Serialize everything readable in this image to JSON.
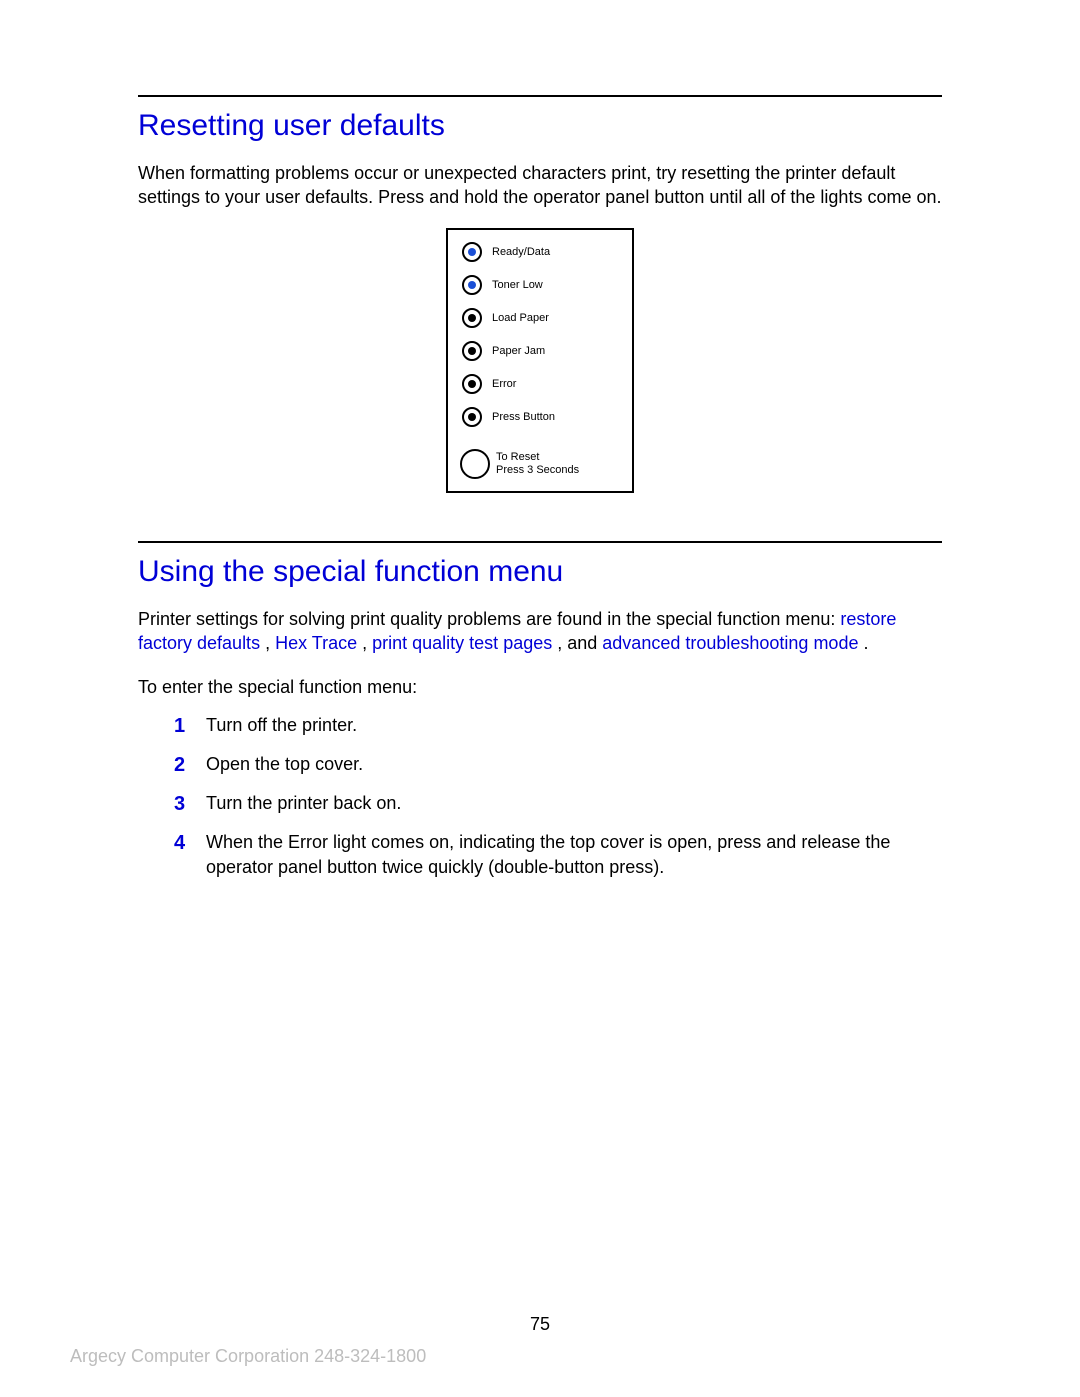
{
  "section1": {
    "heading": "Resetting user defaults",
    "body": "When formatting problems occur or unexpected characters print, try resetting the printer default settings to your user defaults. Press and hold the operator panel button until all of the lights come on."
  },
  "panel": {
    "lights": [
      {
        "label": "Ready/Data",
        "color": "blue"
      },
      {
        "label": "Toner Low",
        "color": "blue"
      },
      {
        "label": "Load Paper",
        "color": "black"
      },
      {
        "label": "Paper Jam",
        "color": "black"
      },
      {
        "label": "Error",
        "color": "black"
      },
      {
        "label": "Press Button",
        "color": "black"
      }
    ],
    "button_line1": "To Reset",
    "button_line2": "Press 3 Seconds"
  },
  "section2": {
    "heading": "Using the special function menu",
    "intro_prefix": "Printer settings for solving print quality problems are found in the special function menu: ",
    "links": {
      "a": "restore factory defaults",
      "b": "Hex Trace",
      "c": "print quality test pages",
      "d": "advanced troubleshooting mode"
    },
    "sep1": " , ",
    "sep2": " , ",
    "sep3": "  , and ",
    "tail": "  .",
    "enter_text": "To enter the special function menu:",
    "steps": [
      "Turn off the printer.",
      "Open the top cover.",
      "Turn the printer back on.",
      "When the Error light comes on, indicating the top cover is open, press and release the operator panel button twice quickly (double-button press)."
    ]
  },
  "page_number": "75",
  "footer": "Argecy Computer Corporation 248-324-1800"
}
